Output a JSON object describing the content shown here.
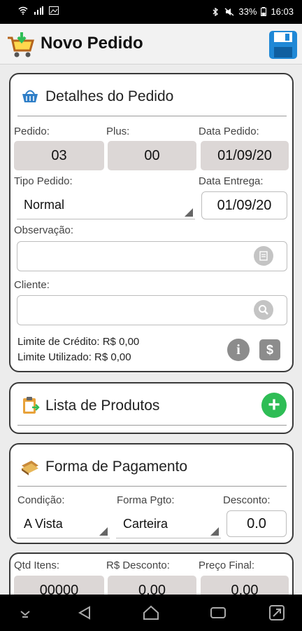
{
  "status_bar": {
    "battery": "33%",
    "time": "16:03"
  },
  "app_bar": {
    "title": "Novo Pedido"
  },
  "detalhes": {
    "title": "Detalhes do Pedido",
    "pedido_label": "Pedido:",
    "pedido_value": "03",
    "plus_label": "Plus:",
    "plus_value": "00",
    "data_pedido_label": "Data Pedido:",
    "data_pedido_value": "01/09/20",
    "tipo_label": "Tipo Pedido:",
    "tipo_value": "Normal",
    "data_entrega_label": "Data Entrega:",
    "data_entrega_value": "01/09/20",
    "observacao_label": "Observação:",
    "observacao_value": "",
    "cliente_label": "Cliente:",
    "cliente_value": "",
    "limite_credito": "Limite de Crédito: R$ 0,00",
    "limite_utilizado": "Limite Utilizado: R$ 0,00",
    "info_glyph": "i",
    "money_glyph": "$"
  },
  "produtos": {
    "title": "Lista de Produtos"
  },
  "pagamento": {
    "title": "Forma de Pagamento",
    "condicao_label": "Condição:",
    "condicao_value": "A Vista",
    "forma_label": "Forma Pgto:",
    "forma_value": "Carteira",
    "desconto_label": "Desconto:",
    "desconto_value": "0.0"
  },
  "totais": {
    "qtd_label": "Qtd Itens:",
    "qtd_value": "00000",
    "rs_desconto_label": "R$ Desconto:",
    "rs_desconto_value": "0,00",
    "preco_final_label": "Preço Final:",
    "preco_final_value": "0,00"
  },
  "colors": {
    "accent_green": "#2ebd55",
    "field_gray": "#dcd7d6",
    "save_blue": "#1f88d6"
  }
}
